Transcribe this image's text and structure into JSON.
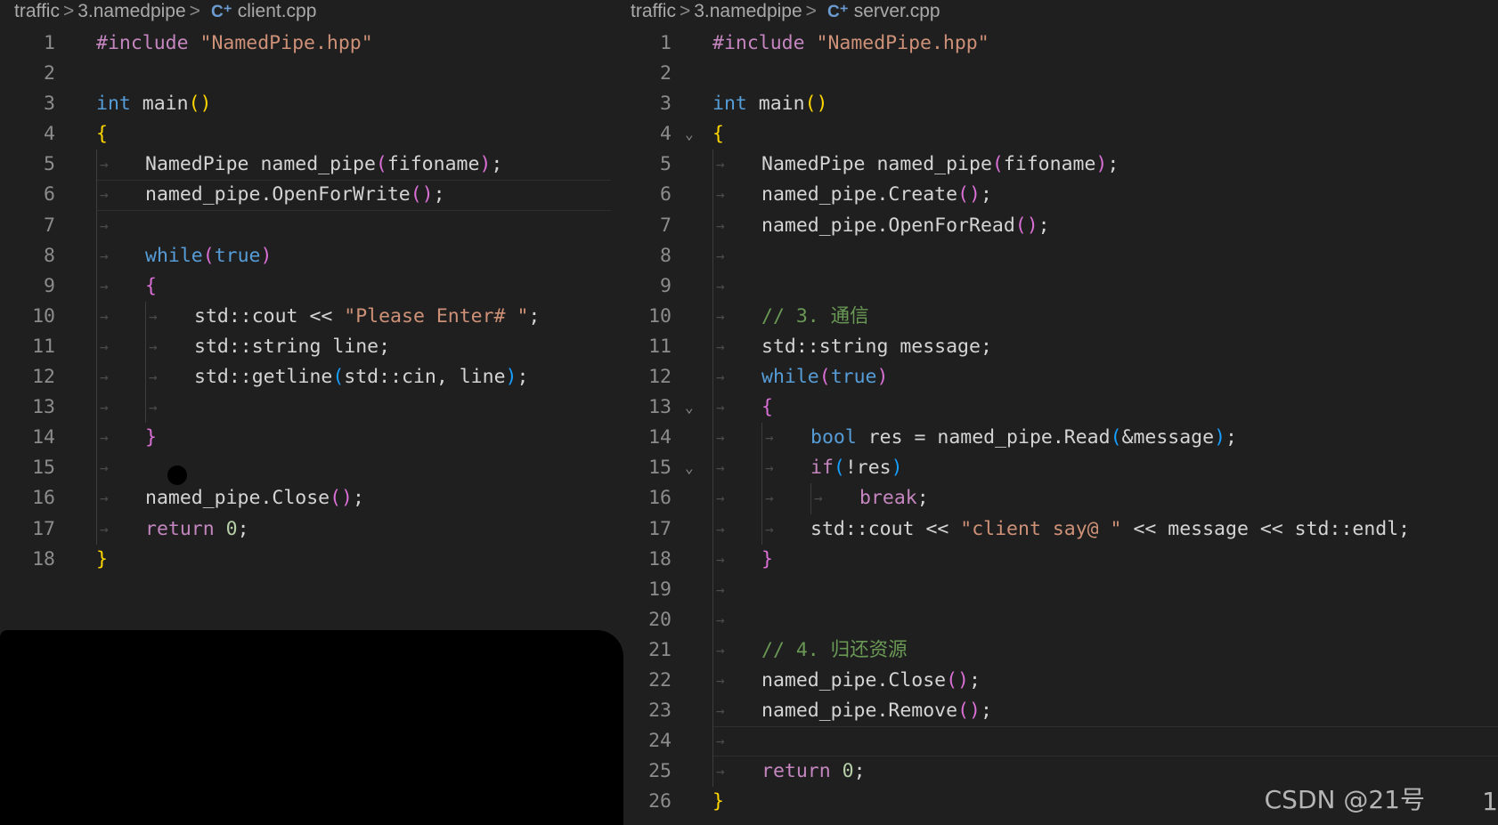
{
  "left": {
    "breadcrumbs": [
      "traffic",
      "3.namedpipe",
      "client.cpp"
    ],
    "lines": [
      {
        "n": "1",
        "indent": 0,
        "tokens": [
          [
            "pp",
            "#include"
          ],
          [
            "id",
            " "
          ],
          [
            "str",
            "\"NamedPipe.hpp\""
          ]
        ]
      },
      {
        "n": "2",
        "indent": 0,
        "tokens": []
      },
      {
        "n": "3",
        "indent": 0,
        "tokens": [
          [
            "kw",
            "int"
          ],
          [
            "id",
            " main"
          ],
          [
            "bl1",
            "()"
          ]
        ]
      },
      {
        "n": "4",
        "indent": 0,
        "tokens": [
          [
            "bl1",
            "{"
          ]
        ]
      },
      {
        "n": "5",
        "indent": 1,
        "tokens": [
          [
            "ty",
            "NamedPipe named_pipe"
          ],
          [
            "bl2",
            "("
          ],
          [
            "id",
            "fifoname"
          ],
          [
            "bl2",
            ")"
          ],
          [
            "id",
            ";"
          ]
        ]
      },
      {
        "n": "6",
        "indent": 1,
        "tokens": [
          [
            "id",
            "named_pipe.OpenForWrite"
          ],
          [
            "bl2",
            "()"
          ],
          [
            "id",
            ";"
          ]
        ]
      },
      {
        "n": "7",
        "indent": 1,
        "tokens": []
      },
      {
        "n": "8",
        "indent": 1,
        "tokens": [
          [
            "kw",
            "while"
          ],
          [
            "bl2",
            "("
          ],
          [
            "kw",
            "true"
          ],
          [
            "bl2",
            ")"
          ]
        ]
      },
      {
        "n": "9",
        "indent": 1,
        "tokens": [
          [
            "bl2",
            "{"
          ]
        ]
      },
      {
        "n": "10",
        "indent": 2,
        "tokens": [
          [
            "id",
            "std::cout << "
          ],
          [
            "str",
            "\"Please Enter# \""
          ],
          [
            "id",
            ";"
          ]
        ]
      },
      {
        "n": "11",
        "indent": 2,
        "tokens": [
          [
            "id",
            "std::string line;"
          ]
        ]
      },
      {
        "n": "12",
        "indent": 2,
        "tokens": [
          [
            "id",
            "std::getline"
          ],
          [
            "bl3",
            "("
          ],
          [
            "id",
            "std::cin, line"
          ],
          [
            "bl3",
            ")"
          ],
          [
            "id",
            ";"
          ]
        ]
      },
      {
        "n": "13",
        "indent": 2,
        "tokens": []
      },
      {
        "n": "14",
        "indent": 1,
        "tokens": [
          [
            "bl2",
            "}"
          ]
        ]
      },
      {
        "n": "15",
        "indent": 1,
        "tokens": []
      },
      {
        "n": "16",
        "indent": 1,
        "tokens": [
          [
            "id",
            "named_pipe.Close"
          ],
          [
            "bl2",
            "()"
          ],
          [
            "id",
            ";"
          ]
        ]
      },
      {
        "n": "17",
        "indent": 1,
        "tokens": [
          [
            "kw2",
            "return"
          ],
          [
            "id",
            " "
          ],
          [
            "num",
            "0"
          ],
          [
            "id",
            ";"
          ]
        ]
      },
      {
        "n": "18",
        "indent": 0,
        "tokens": [
          [
            "bl1",
            "}"
          ]
        ]
      }
    ]
  },
  "right": {
    "breadcrumbs": [
      "traffic",
      "3.namedpipe",
      "server.cpp"
    ],
    "lines": [
      {
        "n": "1",
        "indent": 0,
        "tokens": [
          [
            "pp",
            "#include"
          ],
          [
            "id",
            " "
          ],
          [
            "str",
            "\"NamedPipe.hpp\""
          ]
        ]
      },
      {
        "n": "2",
        "indent": 0,
        "tokens": []
      },
      {
        "n": "3",
        "indent": 0,
        "tokens": [
          [
            "kw",
            "int"
          ],
          [
            "id",
            " main"
          ],
          [
            "bl1",
            "()"
          ]
        ]
      },
      {
        "n": "4",
        "indent": 0,
        "fold": true,
        "tokens": [
          [
            "bl1",
            "{"
          ]
        ]
      },
      {
        "n": "5",
        "indent": 1,
        "tokens": [
          [
            "ty",
            "NamedPipe named_pipe"
          ],
          [
            "bl2",
            "("
          ],
          [
            "id",
            "fifoname"
          ],
          [
            "bl2",
            ")"
          ],
          [
            "id",
            ";"
          ]
        ]
      },
      {
        "n": "6",
        "indent": 1,
        "tokens": [
          [
            "id",
            "named_pipe.Create"
          ],
          [
            "bl2",
            "()"
          ],
          [
            "id",
            ";"
          ]
        ]
      },
      {
        "n": "7",
        "indent": 1,
        "tokens": [
          [
            "id",
            "named_pipe.OpenForRead"
          ],
          [
            "bl2",
            "()"
          ],
          [
            "id",
            ";"
          ]
        ]
      },
      {
        "n": "8",
        "indent": 1,
        "tokens": []
      },
      {
        "n": "9",
        "indent": 1,
        "tokens": []
      },
      {
        "n": "10",
        "indent": 1,
        "tokens": [
          [
            "cmt",
            "// 3. 通信"
          ]
        ]
      },
      {
        "n": "11",
        "indent": 1,
        "tokens": [
          [
            "id",
            "std::string message;"
          ]
        ]
      },
      {
        "n": "12",
        "indent": 1,
        "tokens": [
          [
            "kw",
            "while"
          ],
          [
            "bl2",
            "("
          ],
          [
            "kw",
            "true"
          ],
          [
            "bl2",
            ")"
          ]
        ]
      },
      {
        "n": "13",
        "indent": 1,
        "fold": true,
        "tokens": [
          [
            "bl2",
            "{"
          ]
        ]
      },
      {
        "n": "14",
        "indent": 2,
        "tokens": [
          [
            "kw",
            "bool"
          ],
          [
            "id",
            " res = named_pipe.Read"
          ],
          [
            "bl3",
            "("
          ],
          [
            "id",
            "&message"
          ],
          [
            "bl3",
            ")"
          ],
          [
            "id",
            ";"
          ]
        ]
      },
      {
        "n": "15",
        "indent": 2,
        "fold": true,
        "tokens": [
          [
            "kw2",
            "if"
          ],
          [
            "bl3",
            "("
          ],
          [
            "id",
            "!res"
          ],
          [
            "bl3",
            ")"
          ]
        ]
      },
      {
        "n": "16",
        "indent": 3,
        "tokens": [
          [
            "kw2",
            "break"
          ],
          [
            "id",
            ";"
          ]
        ]
      },
      {
        "n": "17",
        "indent": 2,
        "tokens": [
          [
            "id",
            "std::cout << "
          ],
          [
            "str",
            "\"client say@ \""
          ],
          [
            "id",
            " << message << std::endl;"
          ]
        ]
      },
      {
        "n": "18",
        "indent": 1,
        "tokens": [
          [
            "bl2",
            "}"
          ]
        ]
      },
      {
        "n": "19",
        "indent": 1,
        "tokens": []
      },
      {
        "n": "20",
        "indent": 1,
        "tokens": []
      },
      {
        "n": "21",
        "indent": 1,
        "tokens": [
          [
            "cmt",
            "// 4. 归还资源"
          ]
        ]
      },
      {
        "n": "22",
        "indent": 1,
        "tokens": [
          [
            "id",
            "named_pipe.Close"
          ],
          [
            "bl2",
            "()"
          ],
          [
            "id",
            ";"
          ]
        ]
      },
      {
        "n": "23",
        "indent": 1,
        "tokens": [
          [
            "id",
            "named_pipe.Remove"
          ],
          [
            "bl2",
            "()"
          ],
          [
            "id",
            ";"
          ]
        ]
      },
      {
        "n": "24",
        "indent": 1,
        "tokens": []
      },
      {
        "n": "25",
        "indent": 1,
        "tokens": [
          [
            "kw2",
            "return"
          ],
          [
            "id",
            " "
          ],
          [
            "num",
            "0"
          ],
          [
            "id",
            ";"
          ]
        ]
      },
      {
        "n": "26",
        "indent": 0,
        "tokens": [
          [
            "bl1",
            "}"
          ]
        ]
      }
    ]
  },
  "watermark": "CSDN @21号",
  "corner_number": "1",
  "cpp_icon": "C⁺"
}
